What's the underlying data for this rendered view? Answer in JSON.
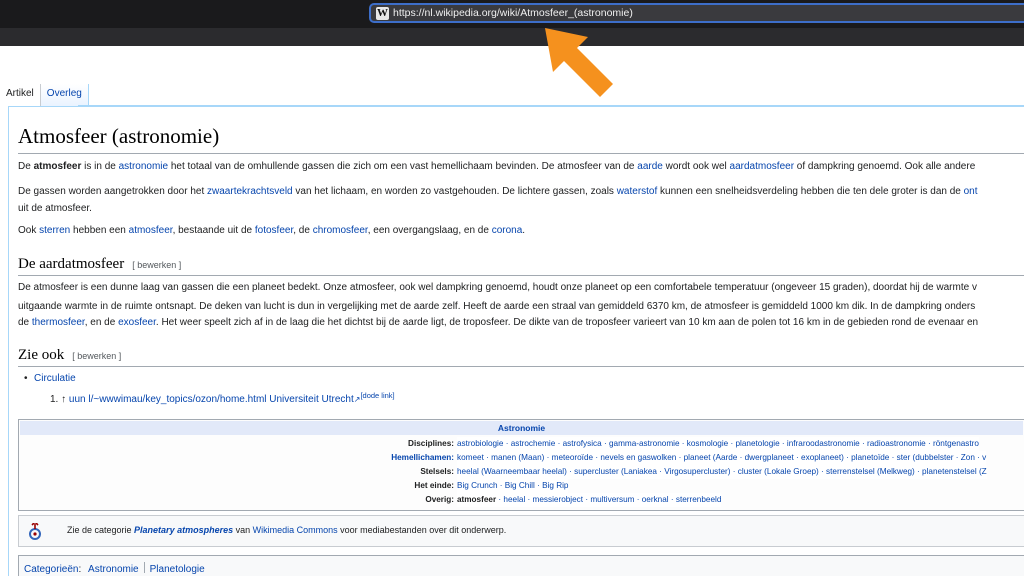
{
  "browser": {
    "favicon_glyph": "W",
    "url": "https://nl.wikipedia.org/wiki/Atmosfeer_(astronomie)",
    "accent_color": "#3d6ec9"
  },
  "arrow": {
    "color": "#f5911e",
    "icon": "arrow-pointer-icon"
  },
  "tabs": [
    {
      "label": "Artikel"
    },
    {
      "label": "Overleg"
    }
  ],
  "article": {
    "title": "Atmosfeer (astronomie)",
    "intro": {
      "p1": {
        "t1": "De ",
        "b1": "atmosfeer",
        "t2": " is in de ",
        "l1": "astronomie",
        "t3": " het totaal van de omhullende gassen die zich om een vast hemellichaam bevinden. De atmosfeer van de ",
        "l2": "aarde",
        "t4": " wordt ook wel ",
        "l3": "aardatmosfeer",
        "t5": " of dampkring genoemd. Ook alle andere"
      },
      "p2": {
        "t1": "De gassen worden aangetrokken door het ",
        "l1": "zwaartekrachtsveld",
        "t2": " van het lichaam, en worden zo vastgehouden. De lichtere gassen, zoals ",
        "l2": "waterstof",
        "t3": " kunnen een snelheidsverdeling hebben die ten dele groter is dan de ",
        "l3": "ont",
        "line2": "uit de atmosfeer."
      },
      "p3": {
        "t1": "Ook ",
        "l1": "sterren",
        "t2": " hebben een ",
        "l2": "atmosfeer",
        "t3": ", bestaande uit de ",
        "l3": "fotosfeer",
        "t4": ", de ",
        "l4": "chromosfeer",
        "t5": ", een overgangslaag, en de ",
        "l5": "corona",
        "t6": "."
      }
    },
    "section1": {
      "heading": "De aardatmosfeer",
      "edit": "[ bewerken ]",
      "line1": "De atmosfeer is een dunne laag van gassen die een planeet bedekt. Onze atmosfeer, ook wel dampkring genoemd, houdt onze planeet op een comfortabele temperatuur (ongeveer 15 graden), doordat hij de warmte v",
      "line2": "uitgaande warmte in de ruimte ontsnapt. De deken van lucht is dun in vergelijking met de aarde zelf. Heeft de aarde een straal van gemiddeld 6370 km, de atmosfeer is gemiddeld 1000 km dik. In de dampkring onders",
      "line3": {
        "t1": "de ",
        "l1": "thermosfeer",
        "t2": ", en de ",
        "l2": "exosfeer",
        "t3": ". Het weer speelt zich af in de laag die het dichtst bij de aarde ligt, de troposfeer. De dikte van de troposfeer varieert van 10 km aan de polen tot 16 km in de gebieden rond de evenaar en"
      }
    },
    "section2": {
      "heading": "Zie ook",
      "edit": "[ bewerken ]",
      "bullet": "Circulatie",
      "ref_num": "1.",
      "ref_arrow": "↑",
      "ref_link": "uun l/~wwwimau/key_topics/ozon/home.html Universiteit Utrecht",
      "ref_dode": "[dode link]"
    }
  },
  "navbox": {
    "title": "Astronomie",
    "rows": [
      {
        "label": "Disciplines:",
        "items": "astrobiologie · astrochemie · astrofysica · gamma-astronomie · kosmologie · planetologie · infraroodastronomie · radioastronomie · röntgenastro"
      },
      {
        "label": "Hemellichamen:",
        "items": "komeet · manen (Maan) · meteoroïde · nevels en gaswolken · planeet (Aarde · dwergplaneet · exoplaneet) · planetoïde · ster (dubbelster · Zon · v"
      },
      {
        "label": "Stelsels:",
        "items": "heelal (Waarneembaar heelal) · supercluster (Laniakea · Virgosupercluster) · cluster (Lokale Groep) · sterrenstelsel (Melkweg) · planetenstelsel (Z"
      },
      {
        "label": "Het einde:",
        "items": "Big Crunch · Big Chill · Big Rip"
      },
      {
        "label": "Overig:",
        "bold": "atmosfeer",
        "items": " · heelal · messierobject · multiversum · oerknal · sterrenbeeld"
      }
    ]
  },
  "commons": {
    "icon": "wikimedia-commons-icon",
    "t1": "Zie de categorie ",
    "l1": "Planetary atmospheres",
    "t2": " van ",
    "l2": "Wikimedia Commons",
    "t3": " voor mediabestanden over dit onderwerp."
  },
  "categories": {
    "label": "Categorieën",
    "colon": ":",
    "items": [
      "Astronomie",
      "Planetologie"
    ]
  }
}
